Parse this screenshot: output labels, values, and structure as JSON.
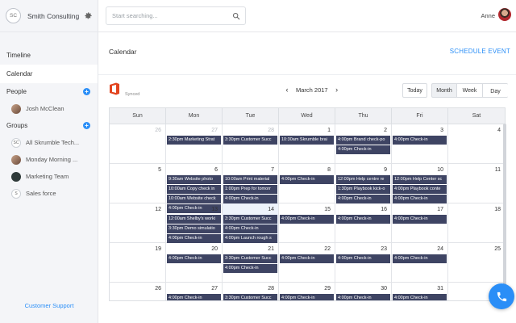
{
  "brand": {
    "initials": "SC",
    "name": "Smith Consulting",
    "icon": "gear-icon"
  },
  "search": {
    "placeholder": "Start searching..."
  },
  "user": {
    "name": "Anne"
  },
  "nav": [
    {
      "label": "Timeline"
    },
    {
      "label": "Calendar",
      "active": true
    }
  ],
  "people": {
    "heading": "People",
    "items": [
      {
        "label": "Josh McClean"
      }
    ]
  },
  "groups": {
    "heading": "Groups",
    "items": [
      {
        "label": "All Skrumble Tech...",
        "avatar": "SC"
      },
      {
        "label": "Monday Morning ..."
      },
      {
        "label": "Marketing Team"
      },
      {
        "label": "Sales force",
        "avatar": "S"
      }
    ]
  },
  "support": "Customer Support",
  "page": {
    "title": "Calendar",
    "schedule_label": "SCHEDULE EVENT",
    "synced": "Synced"
  },
  "month_nav": {
    "label": "March 2017",
    "prev_icon": "chevron-left-icon",
    "next_icon": "chevron-right-icon"
  },
  "views": {
    "today": "Today",
    "month": "Month",
    "week": "Week",
    "day": "Day"
  },
  "colors": {
    "accent": "#2a8ef7",
    "event": "#3e4463",
    "today_cell": "#eef3fb"
  },
  "calendar": {
    "weekdays": [
      "Sun",
      "Mon",
      "Tue",
      "Wed",
      "Thu",
      "Fri",
      "Sat"
    ],
    "weeks": [
      [
        {
          "d": "26",
          "other": true,
          "events": []
        },
        {
          "d": "27",
          "other": true,
          "events": [
            "2:30pm Marketing Strat"
          ]
        },
        {
          "d": "28",
          "other": true,
          "events": [
            "3:30pm Customer Succ"
          ]
        },
        {
          "d": "1",
          "events": [
            "10:30am Skrumble brai"
          ]
        },
        {
          "d": "2",
          "events": [
            "4:00pm Brand check-po",
            "4:00pm Check-in"
          ]
        },
        {
          "d": "3",
          "events": [
            "4:00pm Check-in"
          ]
        },
        {
          "d": "4",
          "events": []
        }
      ],
      [
        {
          "d": "5",
          "events": []
        },
        {
          "d": "6",
          "events": [
            "9:30am Website photo",
            "10:00am Copy check in",
            "10:00am Website check",
            "4:00pm Check-in"
          ]
        },
        {
          "d": "7",
          "events": [
            "10:00am Print material",
            "1:00pm Prep for tomorr",
            "4:00pm Check-in",
            "4:00pm Prep for DX3 to"
          ]
        },
        {
          "d": "8",
          "events": [
            "4:00pm Check-in"
          ]
        },
        {
          "d": "9",
          "events": [
            "12:00pm Help centre re",
            "1:30pm Playbook kick-o",
            "4:00pm Check-in"
          ]
        },
        {
          "d": "10",
          "events": [
            "12:00pm Help Center sc",
            "4:00pm Playbook conte",
            "4:00pm Check-in"
          ]
        },
        {
          "d": "11",
          "events": []
        }
      ],
      [
        {
          "d": "12",
          "events": []
        },
        {
          "d": "13",
          "events": [
            "12:00am Shelby's worki",
            "3:30pm Demo simulatio",
            "4:00pm Check-in"
          ]
        },
        {
          "d": "14",
          "today": true,
          "events": [
            "3:30pm Customer Succ",
            "4:00pm Check-in",
            "4:00pm Launch rough s"
          ]
        },
        {
          "d": "15",
          "events": [
            "4:00pm Check-in"
          ]
        },
        {
          "d": "16",
          "events": [
            "4:00pm Check-in"
          ]
        },
        {
          "d": "17",
          "events": [
            "4:00pm Check-in"
          ]
        },
        {
          "d": "18",
          "events": []
        }
      ],
      [
        {
          "d": "19",
          "events": []
        },
        {
          "d": "20",
          "events": [
            "4:00pm Check-in"
          ]
        },
        {
          "d": "21",
          "events": [
            "3:30pm Customer Succ",
            "4:00pm Check-in"
          ]
        },
        {
          "d": "22",
          "events": [
            "4:00pm Check-in"
          ]
        },
        {
          "d": "23",
          "events": [
            "4:00pm Check-in"
          ]
        },
        {
          "d": "24",
          "events": [
            "4:00pm Check-in"
          ]
        },
        {
          "d": "25",
          "events": []
        }
      ],
      [
        {
          "d": "26",
          "events": []
        },
        {
          "d": "27",
          "events": [
            "4:00pm Check-in"
          ]
        },
        {
          "d": "28",
          "events": [
            "3:30pm Customer Succ",
            "4:00pm Check-in"
          ]
        },
        {
          "d": "29",
          "events": [
            "4:00pm Check-in"
          ]
        },
        {
          "d": "30",
          "events": [
            "4:00pm Check-in"
          ]
        },
        {
          "d": "31",
          "events": [
            "4:00pm Check-in"
          ]
        },
        {
          "d": "1",
          "other": true,
          "events": []
        }
      ]
    ]
  }
}
